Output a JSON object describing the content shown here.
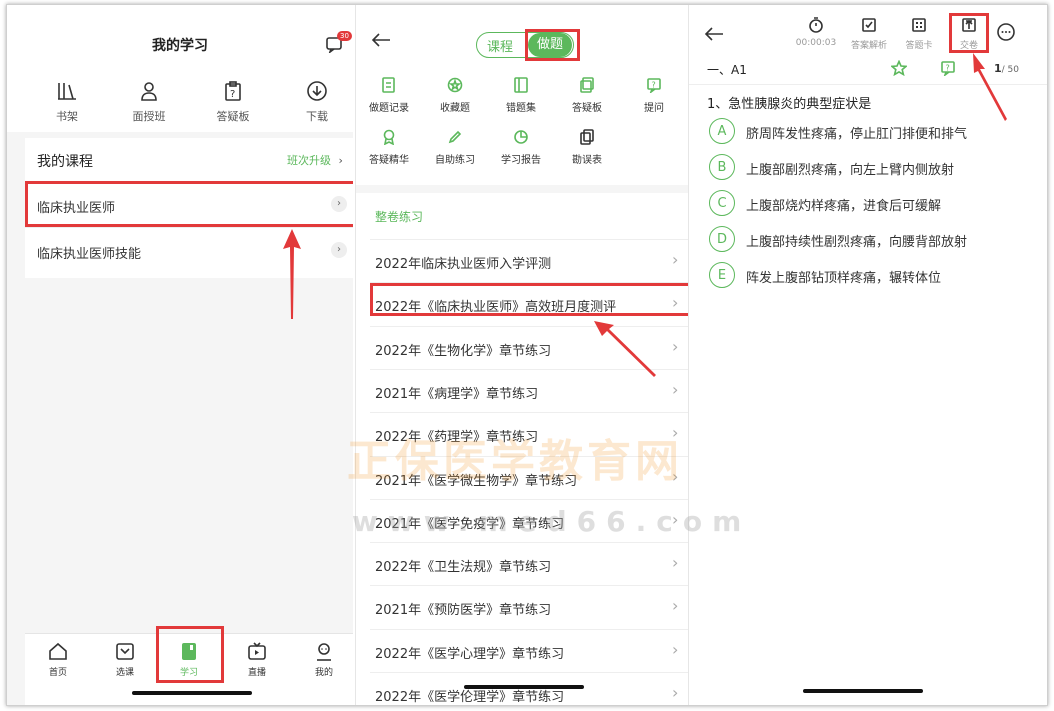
{
  "left": {
    "title": "我的学习",
    "msg_badge": "30",
    "icons": [
      {
        "label": "书架",
        "icon": "bookshelf-icon"
      },
      {
        "label": "面授班",
        "icon": "person-icon"
      },
      {
        "label": "答疑板",
        "icon": "question-board-icon"
      },
      {
        "label": "下载",
        "icon": "download-icon"
      }
    ],
    "my_courses": "我的课程",
    "upgrade": "班次升级",
    "courses": [
      "临床执业医师",
      "临床执业医师技能"
    ],
    "tabbar": [
      {
        "label": "首页",
        "icon": "home-icon"
      },
      {
        "label": "选课",
        "icon": "course-select-icon"
      },
      {
        "label": "学习",
        "icon": "study-icon"
      },
      {
        "label": "直播",
        "icon": "live-tv-icon"
      },
      {
        "label": "我的",
        "icon": "profile-icon"
      }
    ]
  },
  "middle": {
    "tabs": {
      "course": "课程",
      "practice": "做题"
    },
    "grid": [
      {
        "label": "做题记录",
        "icon": "record-icon"
      },
      {
        "label": "收藏题",
        "icon": "star-icon"
      },
      {
        "label": "错题集",
        "icon": "wrong-book-icon"
      },
      {
        "label": "答疑板",
        "icon": "qa-board-icon"
      },
      {
        "label": "提问",
        "icon": "ask-icon"
      },
      {
        "label": "答疑精华",
        "icon": "medal-icon"
      },
      {
        "label": "自助练习",
        "icon": "pencil-icon"
      },
      {
        "label": "学习报告",
        "icon": "report-icon"
      },
      {
        "label": "勘误表",
        "icon": "errata-icon"
      }
    ],
    "section": "整卷练习",
    "papers": [
      "2022年临床执业医师入学评测",
      "2022年《临床执业医师》高效班月度测评",
      "2022年《生物化学》章节练习",
      "2021年《病理学》章节练习",
      "2022年《药理学》章节练习",
      "2021年《医学微生物学》章节练习",
      "2021年《医学免疫学》章节练习",
      "2022年《卫生法规》章节练习",
      "2021年《预防医学》章节练习",
      "2022年《医学心理学》章节练习",
      "2022年《医学伦理学》章节练习"
    ]
  },
  "right": {
    "toolbar": [
      {
        "label": "00:00:03",
        "icon": "timer-icon"
      },
      {
        "label": "答案解析",
        "icon": "answer-analysis-icon"
      },
      {
        "label": "答题卡",
        "icon": "answer-card-icon"
      },
      {
        "label": "交卷",
        "icon": "submit-icon"
      }
    ],
    "section": "一、A1",
    "progress": "1",
    "total": "/ 50",
    "question": "1、急性胰腺炎的典型症状是",
    "options": [
      {
        "key": "A",
        "text": "脐周阵发性疼痛，停止肛门排便和排气"
      },
      {
        "key": "B",
        "text": "上腹部剧烈疼痛，向左上臂内侧放射"
      },
      {
        "key": "C",
        "text": "上腹部烧灼样疼痛，进食后可缓解"
      },
      {
        "key": "D",
        "text": "上腹部持续性剧烈疼痛，向腰背部放射"
      },
      {
        "key": "E",
        "text": "阵发上腹部钻顶样疼痛，辗转体位"
      }
    ]
  },
  "watermark": {
    "cn": "正保医学教育网",
    "url": "www.med66.com"
  },
  "colors": {
    "accent": "#5cb85c",
    "highlight": "#e2393a"
  }
}
